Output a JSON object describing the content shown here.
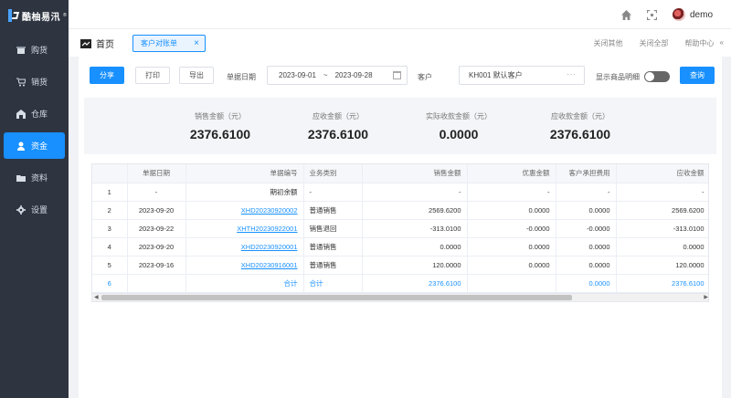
{
  "app": {
    "logo_text": "酷柚易汛",
    "logo_sup": "®"
  },
  "sidebar": {
    "items": [
      {
        "label": "购货",
        "icon": "box-icon",
        "active": false
      },
      {
        "label": "销货",
        "icon": "cart-icon",
        "active": false
      },
      {
        "label": "仓库",
        "icon": "warehouse-icon",
        "active": false
      },
      {
        "label": "资金",
        "icon": "money-icon",
        "active": true
      },
      {
        "label": "资料",
        "icon": "folder-icon",
        "active": false
      },
      {
        "label": "设置",
        "icon": "gear-icon",
        "active": false
      }
    ]
  },
  "topbar": {
    "username": "demo"
  },
  "tabs": {
    "home_label": "首页",
    "open_tab": "客户对账单",
    "close_others": "关闭其他",
    "close_all": "关闭全部",
    "help": "帮助中心",
    "collapse": "«"
  },
  "filter": {
    "share": "分享",
    "print": "打印",
    "export": "导出",
    "date_label": "单据日期",
    "date_from": "2023-09-01",
    "date_sep": "~",
    "date_to": "2023-09-28",
    "customer_label": "客户",
    "customer_value": "KH001 默认客户",
    "customer_more": "···",
    "show_detail": "显示商品明细",
    "show_detail_on": false,
    "query": "查询"
  },
  "summary": [
    {
      "label": "销售金额（元）",
      "value": "2376.6100"
    },
    {
      "label": "应收金额（元）",
      "value": "2376.6100"
    },
    {
      "label": "实际收款金额（元）",
      "value": "0.0000"
    },
    {
      "label": "应收款金额（元）",
      "value": "2376.6100"
    }
  ],
  "table": {
    "headers": [
      "",
      "单据日期",
      "单据编号",
      "业务类别",
      "销售金额",
      "优惠金额",
      "客户承担费用",
      "应收金额"
    ],
    "rows": [
      [
        "1",
        "-",
        "期初余额",
        "-",
        "-",
        "-",
        "-",
        "-"
      ],
      [
        "2",
        "2023-09-20",
        "XHD20230920002",
        "普通销售",
        "2569.6200",
        "0.0000",
        "0.0000",
        "2569.6200"
      ],
      [
        "3",
        "2023-09-22",
        "XHTH20230922001",
        "销售退回",
        "-313.0100",
        "-0.0000",
        "-0.0000",
        "-313.0100"
      ],
      [
        "4",
        "2023-09-20",
        "XHD20230920001",
        "普通销售",
        "0.0000",
        "0.0000",
        "0.0000",
        "0.0000"
      ],
      [
        "5",
        "2023-09-16",
        "XHD20230916001",
        "普通销售",
        "120.0000",
        "0.0000",
        "0.0000",
        "120.0000"
      ]
    ],
    "total": [
      "6",
      "",
      "合计",
      "合计",
      "2376.6100",
      "",
      "0.0000",
      "2376.6100"
    ]
  },
  "colors": {
    "accent": "#1890ff",
    "sidebar_bg": "#2e3541"
  }
}
